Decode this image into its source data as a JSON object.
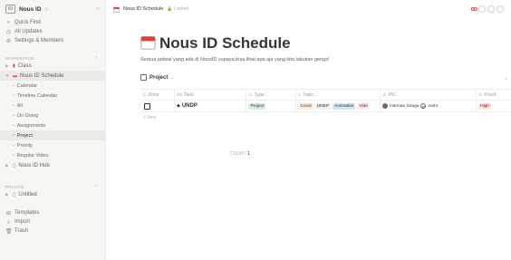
{
  "workspace": {
    "logo": "ID",
    "name": "Nous ID",
    "caret": "◇",
    "collapse": "«"
  },
  "sidebar": {
    "quick": [
      {
        "icon": "⌕",
        "label": "Quick Find"
      },
      {
        "icon": "◷",
        "label": "All Updates"
      },
      {
        "icon": "⚙",
        "label": "Settings & Members"
      }
    ],
    "workspace_section": "WORKSPACE",
    "workspace_plus": "+",
    "pages": [
      {
        "arrow": "▶",
        "icon": "▮",
        "label": "Class"
      },
      {
        "arrow": "▼",
        "icon": "▬",
        "label": "Nous ID Schedule"
      }
    ],
    "views": [
      {
        "label": "Calendar"
      },
      {
        "label": "Timeline Calendar"
      },
      {
        "label": "All"
      },
      {
        "label": "On Going"
      },
      {
        "label": "Assignments"
      },
      {
        "label": "Project"
      },
      {
        "label": "Priority"
      },
      {
        "label": "Regular Video"
      }
    ],
    "hub": {
      "arrow": "▶",
      "icon": "▯",
      "label": "Nous ID Hub"
    },
    "private_section": "PRIVATE",
    "private_plus": "+",
    "untitled": {
      "arrow": "▶",
      "icon": "▯",
      "label": "Untitled"
    },
    "bottom": [
      {
        "icon": "⊞",
        "label": "Templates"
      },
      {
        "icon": "⤓",
        "label": "Import"
      },
      {
        "icon": "🗑",
        "label": "Trash"
      }
    ]
  },
  "topbar": {
    "crumb": "Nous ID Schedule",
    "locked": "🔒 Locked",
    "brand": "oo"
  },
  "page": {
    "title": "Nous ID Schedule",
    "description": "Semua jadwal yang ada di NousID supaya bisa lihat apa aja yang kita lakukan gengs!",
    "view_label": "Project",
    "view_chevron": "⌄"
  },
  "table": {
    "headers": {
      "done": "Done",
      "task": "Task",
      "type": "Type",
      "topic": "Topic",
      "pic": "PIC",
      "priority": "Priorit"
    },
    "header_icons": {
      "done": "☑",
      "task": "Aa",
      "type": "⊙",
      "topic": "≡",
      "pic": "♙",
      "priority": "⊙"
    },
    "rows": [
      {
        "task_icon": "◆",
        "task": "UNDP",
        "type": "Project",
        "topics": [
          "Covid",
          "UNEP",
          "Animation",
          "Vide"
        ],
        "pic1": "Harman Siraga",
        "pic2_initial": "M",
        "pic2": "mahr",
        "priority": "High"
      }
    ],
    "new_label": "+ New",
    "count_label": "COUNT",
    "count_value": "1"
  },
  "colors": {
    "accent_red": "#e03e3e",
    "sidebar_bg": "#f7f6f3"
  }
}
